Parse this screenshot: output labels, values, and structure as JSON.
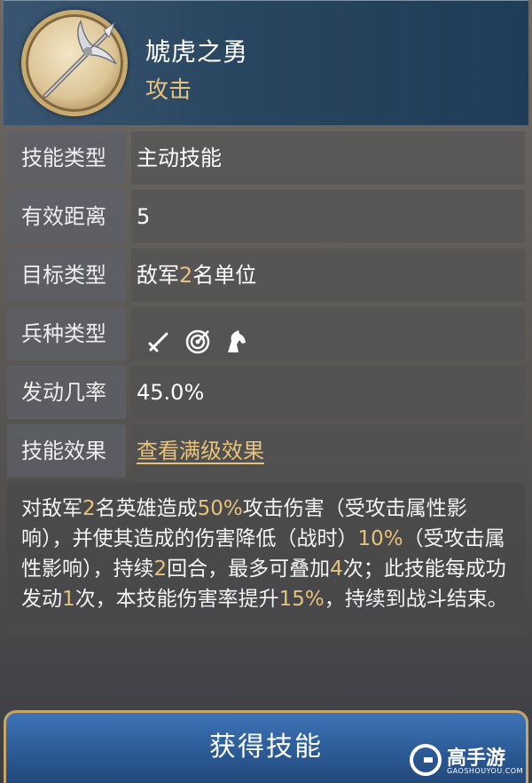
{
  "header": {
    "skill_name": "虓虎之勇",
    "skill_category": "攻击",
    "icon": "halberd-icon"
  },
  "rows": [
    {
      "label": "技能类型",
      "value": "主动技能"
    },
    {
      "label": "有效距离",
      "value": "5"
    },
    {
      "label": "目标类型",
      "value_parts": [
        "敌军",
        "2",
        "名单位"
      ]
    },
    {
      "label": "兵种类型",
      "icons": [
        "sword-icon",
        "target-icon",
        "horse-icon"
      ]
    },
    {
      "label": "发动几率",
      "value": "45.0%"
    },
    {
      "label": "技能效果",
      "link": "查看满级效果"
    }
  ],
  "description": {
    "parts": [
      "对敌军",
      "2",
      "名英雄造成",
      "50%",
      "攻击伤害（受攻击属性影响），并使其造成的伤害降低（战时）",
      "10%",
      "（受攻击属性影响），持续",
      "2",
      "回合，最多可叠加",
      "4",
      "次；此技能每成功发动",
      "1",
      "次，本技能伤害率提升",
      "15%",
      "，持续到战斗结束。"
    ]
  },
  "button": {
    "label": "获得技能"
  },
  "watermark": {
    "brand": "高手游",
    "sub": "GAOSHOUYOU.COM"
  },
  "colors": {
    "accent_gold": "#e6c27a",
    "header_blue": "#294660",
    "button_blue": "#2c5b97"
  }
}
